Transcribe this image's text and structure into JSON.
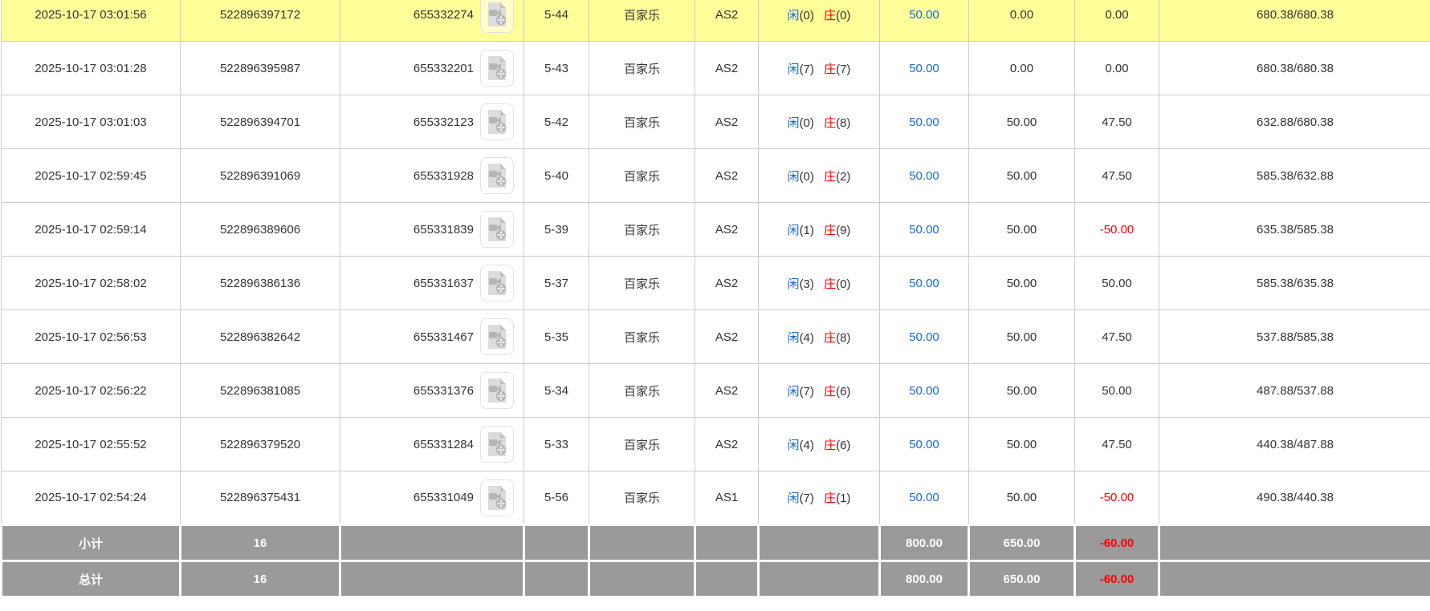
{
  "colors": {
    "highlight_row": "#ffff99",
    "summary_bg": "#9a9a9a",
    "accent_blue": "#1567dc",
    "accent_red": "#fe0000",
    "grid_border": "#cbcbcb"
  },
  "icons": {
    "video": "video-preview-icon"
  },
  "table": {
    "result_labels": {
      "player": "闲",
      "banker": "庄"
    },
    "rows": [
      {
        "highlighted": true,
        "time": "2025-10-17 03:01:56",
        "order_no": "522896397172",
        "round_no": "655332274",
        "shoe_round": "5-44",
        "game": "百家乐",
        "table_name": "AS2",
        "result": {
          "player": "(0)",
          "banker": "(0)"
        },
        "bet": "50.00",
        "valid": "0.00",
        "win_loss": "0.00",
        "balance": "680.38/680.38"
      },
      {
        "highlighted": false,
        "time": "2025-10-17 03:01:28",
        "order_no": "522896395987",
        "round_no": "655332201",
        "shoe_round": "5-43",
        "game": "百家乐",
        "table_name": "AS2",
        "result": {
          "player": "(7)",
          "banker": "(7)"
        },
        "bet": "50.00",
        "valid": "0.00",
        "win_loss": "0.00",
        "balance": "680.38/680.38"
      },
      {
        "highlighted": false,
        "time": "2025-10-17 03:01:03",
        "order_no": "522896394701",
        "round_no": "655332123",
        "shoe_round": "5-42",
        "game": "百家乐",
        "table_name": "AS2",
        "result": {
          "player": "(0)",
          "banker": "(8)"
        },
        "bet": "50.00",
        "valid": "50.00",
        "win_loss": "47.50",
        "balance": "632.88/680.38"
      },
      {
        "highlighted": false,
        "time": "2025-10-17 02:59:45",
        "order_no": "522896391069",
        "round_no": "655331928",
        "shoe_round": "5-40",
        "game": "百家乐",
        "table_name": "AS2",
        "result": {
          "player": "(0)",
          "banker": "(2)"
        },
        "bet": "50.00",
        "valid": "50.00",
        "win_loss": "47.50",
        "balance": "585.38/632.88"
      },
      {
        "highlighted": false,
        "time": "2025-10-17 02:59:14",
        "order_no": "522896389606",
        "round_no": "655331839",
        "shoe_round": "5-39",
        "game": "百家乐",
        "table_name": "AS2",
        "result": {
          "player": "(1)",
          "banker": "(9)"
        },
        "bet": "50.00",
        "valid": "50.00",
        "win_loss": "-50.00",
        "balance": "635.38/585.38"
      },
      {
        "highlighted": false,
        "time": "2025-10-17 02:58:02",
        "order_no": "522896386136",
        "round_no": "655331637",
        "shoe_round": "5-37",
        "game": "百家乐",
        "table_name": "AS2",
        "result": {
          "player": "(3)",
          "banker": "(0)"
        },
        "bet": "50.00",
        "valid": "50.00",
        "win_loss": "50.00",
        "balance": "585.38/635.38"
      },
      {
        "highlighted": false,
        "time": "2025-10-17 02:56:53",
        "order_no": "522896382642",
        "round_no": "655331467",
        "shoe_round": "5-35",
        "game": "百家乐",
        "table_name": "AS2",
        "result": {
          "player": "(4)",
          "banker": "(8)"
        },
        "bet": "50.00",
        "valid": "50.00",
        "win_loss": "47.50",
        "balance": "537.88/585.38"
      },
      {
        "highlighted": false,
        "time": "2025-10-17 02:56:22",
        "order_no": "522896381085",
        "round_no": "655331376",
        "shoe_round": "5-34",
        "game": "百家乐",
        "table_name": "AS2",
        "result": {
          "player": "(7)",
          "banker": "(6)"
        },
        "bet": "50.00",
        "valid": "50.00",
        "win_loss": "50.00",
        "balance": "487.88/537.88"
      },
      {
        "highlighted": false,
        "time": "2025-10-17 02:55:52",
        "order_no": "522896379520",
        "round_no": "655331284",
        "shoe_round": "5-33",
        "game": "百家乐",
        "table_name": "AS2",
        "result": {
          "player": "(4)",
          "banker": "(6)"
        },
        "bet": "50.00",
        "valid": "50.00",
        "win_loss": "47.50",
        "balance": "440.38/487.88"
      },
      {
        "highlighted": false,
        "time": "2025-10-17 02:54:24",
        "order_no": "522896375431",
        "round_no": "655331049",
        "shoe_round": "5-56",
        "game": "百家乐",
        "table_name": "AS1",
        "result": {
          "player": "(7)",
          "banker": "(1)"
        },
        "bet": "50.00",
        "valid": "50.00",
        "win_loss": "-50.00",
        "balance": "490.38/440.38"
      }
    ],
    "summary_rows": [
      {
        "label": "小计",
        "count": "16",
        "bet": "800.00",
        "valid": "650.00",
        "win_loss": "-60.00"
      },
      {
        "label": "总计",
        "count": "16",
        "bet": "800.00",
        "valid": "650.00",
        "win_loss": "-60.00"
      }
    ]
  }
}
